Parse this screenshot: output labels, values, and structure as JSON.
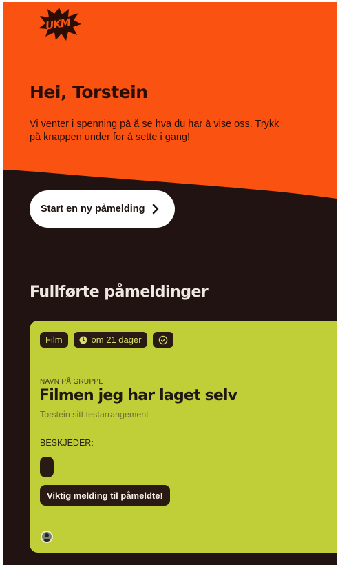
{
  "brand": {
    "logo_text": "UKM",
    "orange": "#fa5210",
    "dark": "#211311",
    "card_green": "#c0cf37"
  },
  "hero": {
    "greeting": "Hei, Torstein",
    "intro": "Vi venter i spenning på å se hva du har å vise oss. Trykk på knappen under for å sette i gang!",
    "start_button": "Start en ny påmelding",
    "start_icon": "chevron-right-icon"
  },
  "completed": {
    "title": "Fullførte påmeldinger",
    "cards": [
      {
        "chips": {
          "category": "Film",
          "time": "om 21 dager",
          "time_icon": "clock-icon",
          "status_icon": "check-circle-icon"
        },
        "group_label": "NAVN PÅ GRUPPE",
        "title": "Filmen jeg har laget selv",
        "subtitle": "Torstein sitt testarrangement",
        "messages_label": "BESKJEDER:",
        "message": "Viktig melding til påmeldte!",
        "avatar_icon": "user-avatar-icon"
      }
    ]
  }
}
